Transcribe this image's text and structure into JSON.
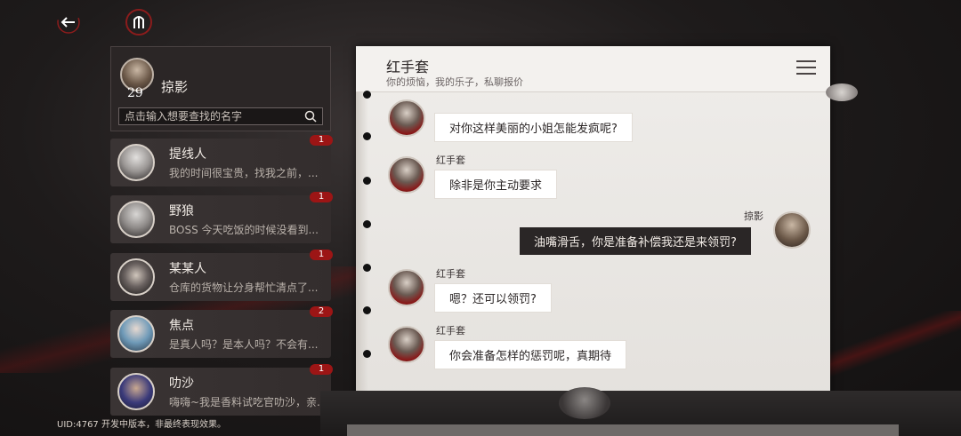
{
  "profile": {
    "name": "掠影",
    "level": "29"
  },
  "search": {
    "placeholder": "点击输入想要查找的名字"
  },
  "contacts": [
    {
      "name": "提线人",
      "preview": "我的时间很宝贵，找我之前，...",
      "badge": "1"
    },
    {
      "name": "野狼",
      "preview": "BOSS 今天吃饭的时候没看到...",
      "badge": "1"
    },
    {
      "name": "某某人",
      "preview": "仓库的货物让分身帮忙清点了...",
      "badge": "1"
    },
    {
      "name": "焦点",
      "preview": "是真人吗？是本人吗？不会有...",
      "badge": "2"
    },
    {
      "name": "叻沙",
      "preview": "嗨嗨~我是香料试吃官叻沙，亲...",
      "badge": "1"
    }
  ],
  "footer": {
    "uid_text": "UID:4767  开发中版本，非最终表现效果。"
  },
  "chat": {
    "title": "红手套",
    "subtitle": "你的烦恼，我的乐子，私聊报价",
    "messages": [
      {
        "sender": "红手套",
        "text": "对你这样美丽的小姐怎能发疯呢?",
        "self": false
      },
      {
        "sender": "红手套",
        "text": "除非是你主动要求",
        "self": false
      },
      {
        "sender": "掠影",
        "text": "油嘴滑舌，你是准备补偿我还是来领罚?",
        "self": true
      },
      {
        "sender": "红手套",
        "text": "嗯？还可以领罚?",
        "self": false
      },
      {
        "sender": "红手套",
        "text": "你会准备怎样的惩罚呢，真期待",
        "self": false
      }
    ]
  },
  "colors": {
    "accent_red": "#9c1515",
    "panel_dark": "#2b2626",
    "paper": "#efedea"
  },
  "icons": {
    "back": "back-arrow-icon",
    "mark": "emblem-icon",
    "search": "search-icon",
    "menu": "menu-icon"
  }
}
